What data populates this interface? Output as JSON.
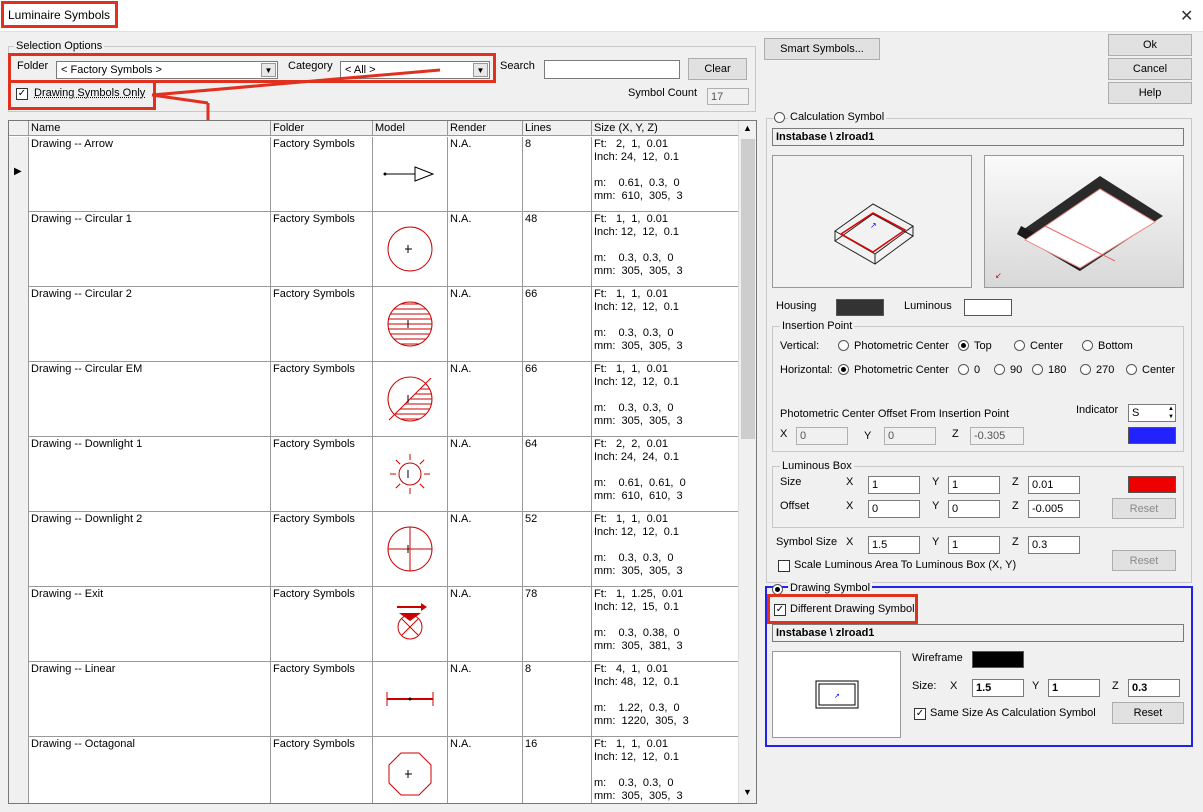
{
  "window": {
    "title": "Luminaire Symbols",
    "close": "✕"
  },
  "selection": {
    "group_label": "Selection Options",
    "folder_label": "Folder",
    "folder_value": "< Factory Symbols >",
    "category_label": "Category",
    "category_value": "< All >",
    "search_label": "Search",
    "search_value": "",
    "clear_label": "Clear",
    "drawing_only_label": "Drawing Symbols Only",
    "drawing_only_checked": "✓",
    "symbol_count_label": "Symbol Count",
    "symbol_count": "17"
  },
  "table": {
    "headers": [
      "Name",
      "Folder",
      "Model",
      "Render",
      "Lines",
      "Size  (X, Y, Z)"
    ],
    "rows": [
      {
        "name": "Drawing -- Arrow",
        "folder": "Factory Symbols",
        "render": "N.A.",
        "lines": "8",
        "size": "Ft:   2,  1,  0.01\nInch: 24,  12,  0.1\n\nm:    0.61,  0.3,  0\nmm:  610,  305,  3",
        "icon": "arrow"
      },
      {
        "name": "Drawing -- Circular 1",
        "folder": "Factory Symbols",
        "render": "N.A.",
        "lines": "48",
        "size": "Ft:   1,  1,  0.01\nInch: 12,  12,  0.1\n\nm:    0.3,  0.3,  0\nmm:  305,  305,  3",
        "icon": "circle"
      },
      {
        "name": "Drawing -- Circular 2",
        "folder": "Factory Symbols",
        "render": "N.A.",
        "lines": "66",
        "size": "Ft:   1,  1,  0.01\nInch: 12,  12,  0.1\n\nm:    0.3,  0.3,  0\nmm:  305,  305,  3",
        "icon": "circle-hatch"
      },
      {
        "name": "Drawing -- Circular EM",
        "folder": "Factory Symbols",
        "render": "N.A.",
        "lines": "66",
        "size": "Ft:   1,  1,  0.01\nInch: 12,  12,  0.1\n\nm:    0.3,  0.3,  0\nmm:  305,  305,  3",
        "icon": "circle-em"
      },
      {
        "name": "Drawing -- Downlight 1",
        "folder": "Factory Symbols",
        "render": "N.A.",
        "lines": "64",
        "size": "Ft:   2,  2,  0.01\nInch: 24,  24,  0.1\n\nm:    0.61,  0.61,  0\nmm:  610,  610,  3",
        "icon": "sun"
      },
      {
        "name": "Drawing -- Downlight 2",
        "folder": "Factory Symbols",
        "render": "N.A.",
        "lines": "52",
        "size": "Ft:   1,  1,  0.01\nInch: 12,  12,  0.1\n\nm:    0.3,  0.3,  0\nmm:  305,  305,  3",
        "icon": "circle-cross"
      },
      {
        "name": "Drawing -- Exit",
        "folder": "Factory Symbols",
        "render": "N.A.",
        "lines": "78",
        "size": "Ft:   1,  1.25,  0.01\nInch: 12,  15,  0.1\n\nm:    0.3,  0.38,  0\nmm:  305,  381,  3",
        "icon": "exit"
      },
      {
        "name": "Drawing -- Linear",
        "folder": "Factory Symbols",
        "render": "N.A.",
        "lines": "8",
        "size": "Ft:   4,  1,  0.01\nInch: 48,  12,  0.1\n\nm:    1.22,  0.3,  0\nmm:  1220,  305,  3",
        "icon": "linear"
      },
      {
        "name": "Drawing -- Octagonal",
        "folder": "Factory Symbols",
        "render": "N.A.",
        "lines": "16",
        "size": "Ft:   1,  1,  0.01\nInch: 12,  12,  0.1\n\nm:    0.3,  0.3,  0\nmm:  305,  305,  3",
        "icon": "octagon"
      }
    ]
  },
  "buttons": {
    "smart_symbols": "Smart Symbols...",
    "ok": "Ok",
    "cancel": "Cancel",
    "help": "Help"
  },
  "calc": {
    "radio_label": "Calculation Symbol",
    "name": "Instabase \\ zlroad1",
    "housing_label": "Housing",
    "luminous_label": "Luminous",
    "housing_color": "#333333",
    "luminous_color": "#ffffff",
    "insertion_label": "Insertion Point",
    "vertical_label": "Vertical:",
    "vertical_options": [
      "Photometric Center",
      "Top",
      "Center",
      "Bottom"
    ],
    "horizontal_label": "Horizontal:",
    "horizontal_options": [
      "Photometric Center",
      "0",
      "90",
      "180",
      "270",
      "Center"
    ],
    "offset_label": "Photometric Center Offset From Insertion Point",
    "indicator_label": "Indicator",
    "indicator_value": "S",
    "indicator_color": "#2222ff",
    "off_x_label": "X",
    "off_x": "0",
    "off_y_label": "Y",
    "off_y": "0",
    "off_z_label": "Z",
    "off_z": "-0.305",
    "luminous_box_label": "Luminous Box",
    "size_label": "Size",
    "offset_row_label": "Offset",
    "x_label": "X",
    "y_label": "Y",
    "z_label": "Z",
    "size_x": "1",
    "size_y": "1",
    "size_z": "0.01",
    "offset_x": "0",
    "offset_y": "0",
    "offset_z": "-0.005",
    "box_color": "#ee0000",
    "reset_label": "Reset",
    "symbol_size_label": "Symbol Size",
    "sym_x": "1.5",
    "sym_y": "1",
    "sym_z": "0.3",
    "scale_label": "Scale Luminous Area To Luminous Box (X, Y)"
  },
  "drawing": {
    "radio_label": "Drawing Symbol",
    "different_label": "Different Drawing Symbol",
    "different_checked": "✓",
    "name": "Instabase \\ zlroad1",
    "wireframe_label": "Wireframe",
    "wireframe_color": "#000000",
    "size_label": "Size:",
    "x_label": "X",
    "y_label": "Y",
    "z_label": "Z",
    "x": "1.5",
    "y": "1",
    "z": "0.3",
    "same_size_label": "Same Size As Calculation Symbol",
    "same_size_checked": "✓",
    "reset_label": "Reset"
  }
}
